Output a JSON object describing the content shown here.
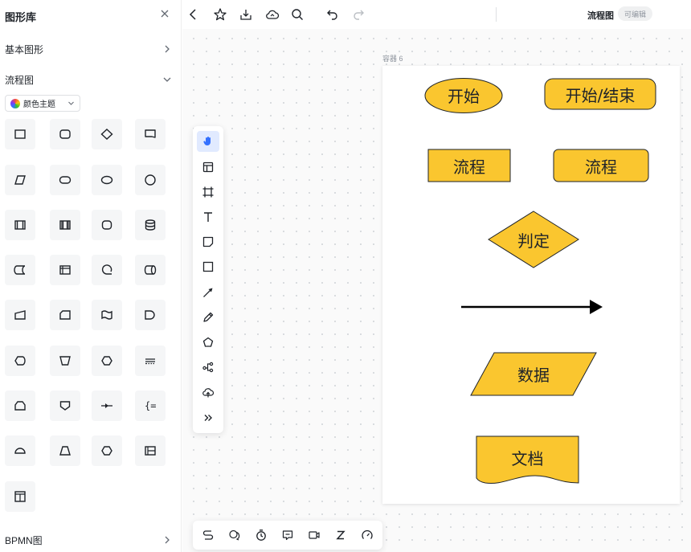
{
  "library": {
    "title": "图形库",
    "sections": {
      "basic": "基本图形",
      "flowchart": "流程图",
      "bpmn": "BPMN图"
    },
    "theme_label": "颜色主题",
    "shape_icons": [
      "rectangle-icon",
      "rounded-rect-icon",
      "diamond-icon",
      "callout-icon",
      "parallelogram-icon",
      "stadium-icon",
      "ellipse-icon",
      "circle-icon",
      "predefined-process-icon",
      "double-process-icon",
      "rounded-square-icon",
      "database-icon",
      "stored-data-icon",
      "internal-storage-icon",
      "sequential-data-icon",
      "direct-data-icon",
      "manual-input-icon",
      "card-icon",
      "punched-tape-icon",
      "delay-icon",
      "display-icon",
      "manual-operation-icon",
      "preparation-icon",
      "note-lines-icon",
      "loop-limit-icon",
      "offpage-connector-icon",
      "collate-icon",
      "annotation-brace-icon",
      "semicircle-icon",
      "trapezoid-icon",
      "hexagon-icon",
      "swimlane-horizontal-icon",
      "swimlane-vertical-icon"
    ]
  },
  "topbar": {
    "title": "流程图",
    "badge": "可编辑"
  },
  "frame": {
    "label": "容器 6"
  },
  "shapes": {
    "start_ellipse": "开始",
    "start_end": "开始/结束",
    "process_rect": "流程",
    "process_rounded": "流程",
    "decision": "判定",
    "data": "数据",
    "document": "文档"
  },
  "colors": {
    "shape_fill": "#fac62f",
    "shape_stroke": "#1f2329",
    "dock_active": "#e1eaff",
    "accent": "#3370ff"
  }
}
